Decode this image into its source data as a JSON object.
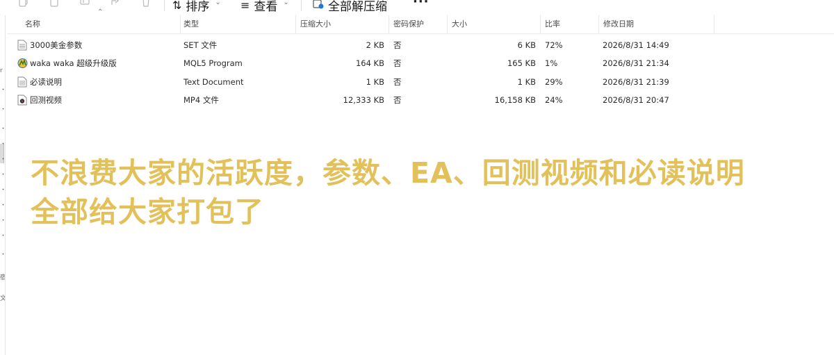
{
  "toolbar": {
    "icons": [
      "copy-icon",
      "paste-icon",
      "rename-icon",
      "share-icon",
      "delete-icon"
    ],
    "sort_label": "排序",
    "view_label": "查看",
    "extract_label": "全部解压缩",
    "more_label": "···"
  },
  "left_pane": {
    "marks": [
      "r",
      "・",
      "・",
      "・",
      "・",
      "・",
      "・",
      "・",
      "・",
      "・",
      "・",
      "・",
      "宿",
      "文"
    ]
  },
  "columns": {
    "name": "名称",
    "type": "类型",
    "compressed_size": "压缩大小",
    "password": "密码保护",
    "size": "大小",
    "ratio": "比率",
    "modified": "修改日期"
  },
  "files": [
    {
      "name": "3000美金参数",
      "icon": "text-file-icon",
      "type": "SET 文件",
      "compressed": "2 KB",
      "password": "否",
      "size": "6 KB",
      "ratio": "72%",
      "modified": "2026/8/31 14:49"
    },
    {
      "name": "waka waka 超级升级版",
      "icon": "mql5-icon",
      "type": "MQL5 Program",
      "compressed": "164 KB",
      "password": "否",
      "size": "165 KB",
      "ratio": "1%",
      "modified": "2026/8/31 21:34"
    },
    {
      "name": "必读说明",
      "icon": "text-file-icon",
      "type": "Text Document",
      "compressed": "1 KB",
      "password": "否",
      "size": "1 KB",
      "ratio": "29%",
      "modified": "2026/8/31 21:39"
    },
    {
      "name": "回测视频",
      "icon": "video-file-icon",
      "type": "MP4 文件",
      "compressed": "12,333 KB",
      "password": "否",
      "size": "16,158 KB",
      "ratio": "24%",
      "modified": "2026/8/31 20:47"
    }
  ],
  "overlay": {
    "line1": "不浪费大家的活跃度，参数、EA、回测视频和必读说明",
    "line2": "全部给大家打包了",
    "color": "#e2c15a"
  }
}
